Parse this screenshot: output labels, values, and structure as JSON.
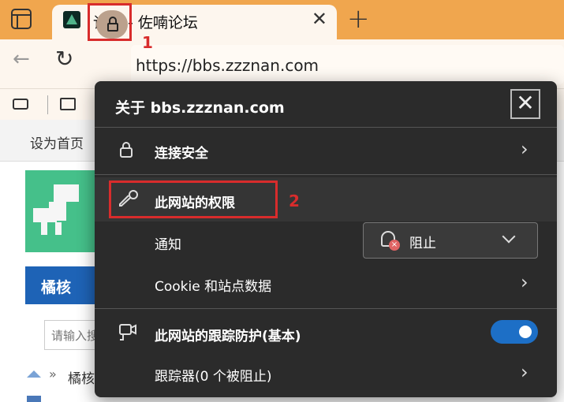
{
  "tab": {
    "title": "论坛 - 佐喃论坛",
    "close": "✕",
    "new_tab": "+"
  },
  "toolbar": {
    "back": "←",
    "reload": "↻",
    "url": "https://bbs.zzznan.com",
    "annotation_1": "1"
  },
  "page": {
    "set_home": "设为首页",
    "nav_label": "橘核",
    "search_placeholder": "请输入搜",
    "breadcrumb_sep": "»",
    "breadcrumb": "橘核"
  },
  "popup": {
    "title": "关于 bbs.zzznan.com",
    "close": "✕",
    "connection": "连接安全",
    "permissions": "此网站的权限",
    "annotation_2": "2",
    "notifications": "通知",
    "notifications_value": "阻止",
    "cookies": "Cookie 和站点数据",
    "tracking": "此网站的跟踪防护(基本)",
    "tracking_enabled": true,
    "trackers": "跟踪器(0 个被阻止)",
    "chevron": "›"
  },
  "colors": {
    "tabbar": "#f0a64e",
    "popup_bg": "#2b2b2b",
    "toggle": "#1d6fc6",
    "annotation": "#d82c2c",
    "nav_blue": "#1e63b6"
  }
}
